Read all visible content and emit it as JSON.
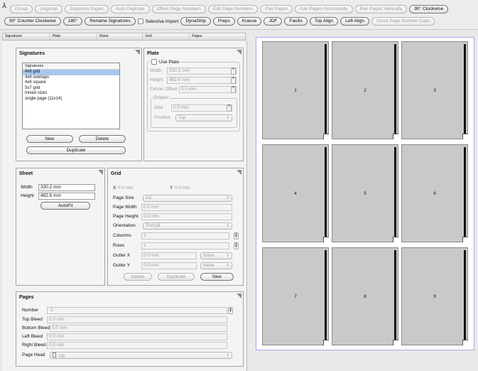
{
  "toolbar": {
    "row1": [
      {
        "label": "Group",
        "disabled": true
      },
      {
        "label": "Ungroup",
        "disabled": true
      },
      {
        "label": "Suppress Pages",
        "disabled": true
      },
      {
        "label": "Auto Paginate",
        "disabled": true
      },
      {
        "label": "Offset Page Numbers",
        "disabled": true
      },
      {
        "label": "Edit Page Numbers",
        "disabled": true
      },
      {
        "label": "Pair Pages",
        "disabled": true
      },
      {
        "label": "Pair Pages Horizontally",
        "disabled": true
      },
      {
        "label": "Pair Pages Vertically",
        "disabled": true
      },
      {
        "label": "90° Clockwise",
        "disabled": false
      }
    ],
    "row2a": [
      {
        "label": "90° Counter Clockwise",
        "disabled": false
      },
      {
        "label": "180°",
        "disabled": false
      },
      {
        "label": "Rename Signatures",
        "disabled": false
      }
    ],
    "selective_import": "Selective Import",
    "row2b": [
      {
        "label": "DynaStrip",
        "disabled": false
      },
      {
        "label": "Preps",
        "disabled": false
      },
      {
        "label": "Krause",
        "disabled": false
      },
      {
        "label": "JDF",
        "disabled": false
      },
      {
        "label": "Facilis",
        "disabled": false
      },
      {
        "label": "Top Align",
        "disabled": false
      },
      {
        "label": "Left Align",
        "disabled": false
      },
      {
        "label": "Close Page Number Caps",
        "disabled": true
      }
    ]
  },
  "columns": [
    "Signatures",
    "Plate",
    "Sheet",
    "Grid",
    "Pages"
  ],
  "signatures": {
    "title": "Signatures",
    "list_header": "Signatures",
    "items": [
      "4x6 grid",
      "4x6 overlaps",
      "4x6 square",
      "5x7 grid",
      "mixed sizes",
      "single page (11x14)"
    ],
    "selected_index": 0,
    "new_label": "New",
    "delete_label": "Delete",
    "duplicate_label": "Duplicate"
  },
  "plate": {
    "title": "Plate",
    "use_plate": "Use Plate",
    "width_label": "Width",
    "width_value": "330.2 mm",
    "height_label": "Height",
    "height_value": "482.6 mm",
    "center_offset_label": "Center Offset",
    "center_offset_value": "0.0 mm",
    "gripper_title": "Gripper",
    "size_label": "Size",
    "size_value": "0.0 mm",
    "position_label": "Position",
    "position_value": "Top"
  },
  "sheet": {
    "title": "Sheet",
    "width_label": "Width",
    "width_value": "330.2 mm",
    "height_label": "Height",
    "height_value": "482.6 mm",
    "autofit_label": "AutoFit"
  },
  "grid": {
    "title": "Grid",
    "x_label": "X",
    "x_value": "0.0 mm",
    "y_label": "Y",
    "y_value": "0.0 mm",
    "page_size_label": "Page Size",
    "page_size_value": "A3",
    "page_width_label": "Page Width",
    "page_width_value": "0.0 mm",
    "page_height_label": "Page Height",
    "page_height_value": "0.0 mm",
    "orientation_label": "Orientation",
    "orientation_value": "Portrait",
    "columns_label": "Columns",
    "columns_value": "1",
    "rows_label": "Rows",
    "rows_value": "1",
    "gutter_x_label": "Gutter X",
    "gutter_x_value": "0.0 mm",
    "gutter_x_mode": "None",
    "gutter_y_label": "Gutter Y",
    "gutter_y_value": "0.0 mm",
    "gutter_y_mode": "None",
    "delete_label": "Delete",
    "duplicate_label": "Duplicate",
    "new_label": "New"
  },
  "pages": {
    "title": "Pages",
    "number_label": "Number",
    "number_value": "-1",
    "top_bleed_label": "Top Bleed",
    "top_bleed_value": "0.0 mm",
    "bottom_bleed_label": "Bottom Bleed",
    "bottom_bleed_value": "0.0 mm",
    "left_bleed_label": "Left Bleed",
    "left_bleed_value": "0.0 mm",
    "right_bleed_label": "Right Bleed",
    "right_bleed_value": "0.0 mm",
    "page_head_label": "Page Head",
    "page_head_value": "Up"
  },
  "preview": {
    "page_numbers": [
      "1",
      "2",
      "3",
      "4",
      "5",
      "6",
      "7",
      "8",
      "9"
    ]
  }
}
